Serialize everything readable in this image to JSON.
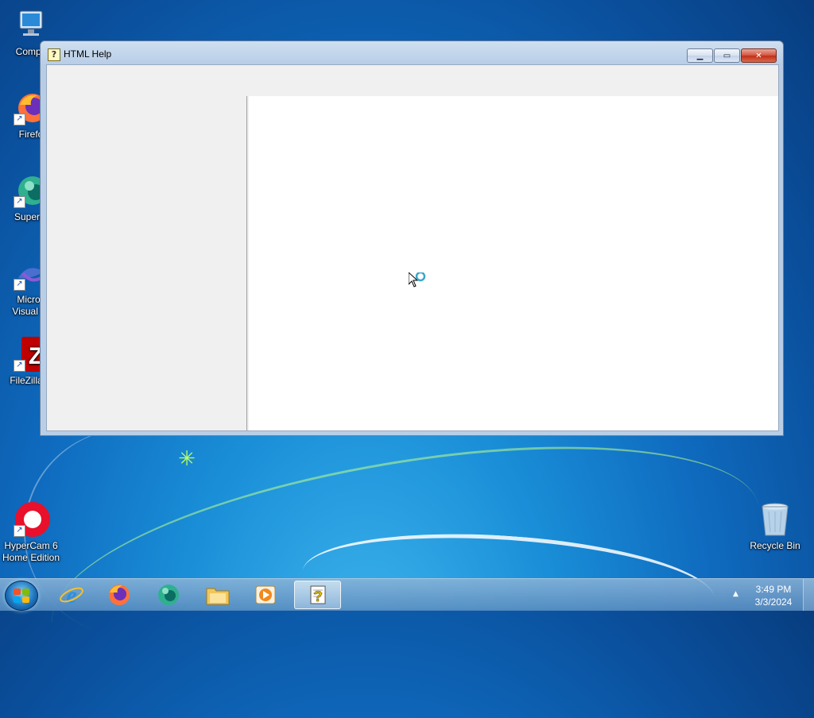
{
  "desktop": {
    "icons": [
      {
        "label": "Compu",
        "icon": "computer-icon"
      },
      {
        "label": "Firefo",
        "icon": "firefox-icon"
      },
      {
        "label": "Superm",
        "icon": "supermium-icon"
      },
      {
        "label": "Micros Visual St",
        "line1": "Micros",
        "line2": "Visual St",
        "icon": "visual-studio-icon"
      },
      {
        "label": "FileZilla C",
        "icon": "filezilla-icon"
      },
      {
        "label": "HyperCam 6 Home Edition",
        "line1": "HyperCam 6",
        "line2": "Home Edition",
        "icon": "hypercam-icon"
      },
      {
        "label": "Recycle Bin",
        "icon": "recycle-bin-icon"
      }
    ]
  },
  "window": {
    "title": "HTML Help",
    "icon": "help-file-icon",
    "buttons": {
      "minimize": "minimize-icon",
      "maximize": "maximize-icon",
      "close": "close-icon"
    }
  },
  "taskbar": {
    "items": [
      {
        "name": "internet-explorer",
        "icon": "internet-explorer-icon"
      },
      {
        "name": "firefox",
        "icon": "firefox-icon"
      },
      {
        "name": "supermium",
        "icon": "supermium-icon"
      },
      {
        "name": "file-explorer",
        "icon": "folder-icon"
      },
      {
        "name": "media-player",
        "icon": "media-player-icon"
      },
      {
        "name": "html-help",
        "icon": "help-file-icon",
        "active": true
      }
    ],
    "clock": {
      "time": "3:49 PM",
      "date": "3/3/2024"
    }
  },
  "colors": {
    "accent": "#1a6fb8",
    "close": "#c12f16",
    "content_bg": "#ffffff",
    "pane_bg": "#f0f0f0"
  }
}
